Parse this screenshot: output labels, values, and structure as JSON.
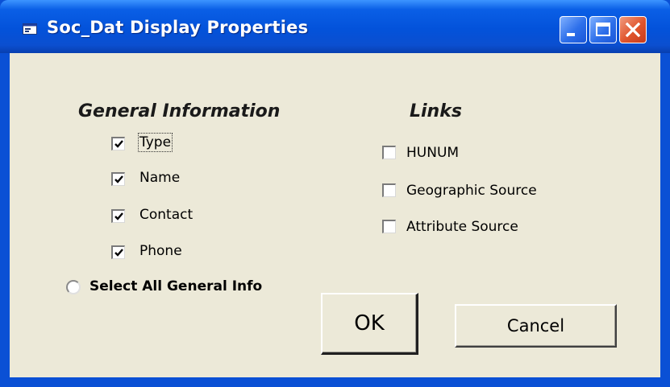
{
  "window": {
    "title": "Soc_Dat Display Properties",
    "title_bar_color": "#0A50D5",
    "client_bg": "#ECE9D8",
    "controls": {
      "minimize": "minimize-icon",
      "maximize": "maximize-icon",
      "close": "close-icon"
    }
  },
  "general_info": {
    "heading": "General Information",
    "items": [
      {
        "label": "Type",
        "checked": true,
        "focused": true
      },
      {
        "label": "Name",
        "checked": true
      },
      {
        "label": "Contact",
        "checked": true
      },
      {
        "label": "Phone",
        "checked": true
      }
    ],
    "select_all_label": "Select All General Info",
    "select_all_selected": false
  },
  "links": {
    "heading": "Links",
    "items": [
      {
        "label": "HUNUM",
        "checked": false
      },
      {
        "label": "Geographic Source",
        "checked": false
      },
      {
        "label": "Attribute Source",
        "checked": false
      }
    ]
  },
  "buttons": {
    "ok_label": "OK",
    "cancel_label": "Cancel"
  }
}
